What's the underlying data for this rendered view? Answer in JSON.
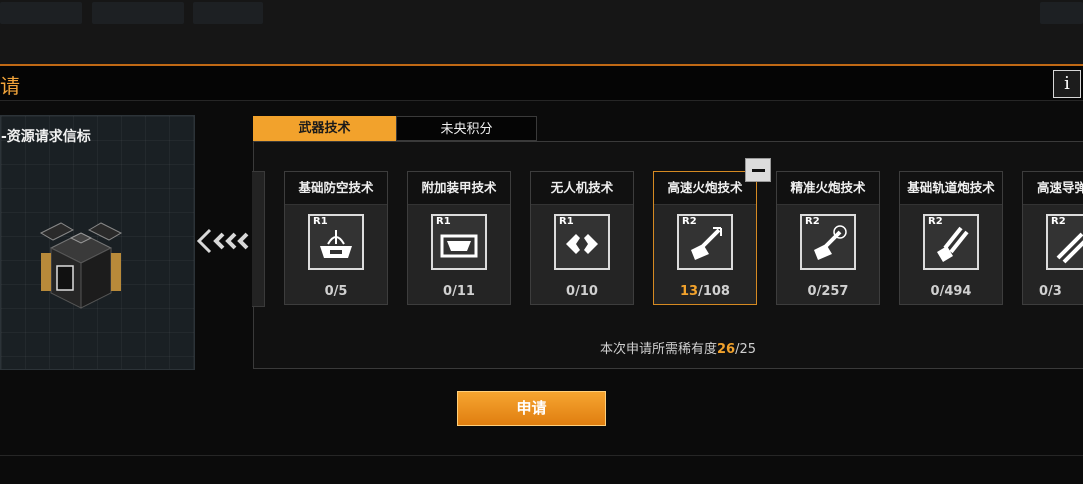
{
  "window": {
    "title": "请"
  },
  "beacon": {
    "name": "-资源请求信标"
  },
  "tabs": [
    {
      "label": "武器技术",
      "active": true
    },
    {
      "label": "未央积分",
      "active": false
    }
  ],
  "tech_cards": [
    {
      "name": "基础防空技术",
      "rank": "R1",
      "icon": "anti-air-icon",
      "current": "0",
      "sep": "/",
      "max": "5",
      "selected": false
    },
    {
      "name": "附加装甲技术",
      "rank": "R1",
      "icon": "armor-icon",
      "current": "0",
      "sep": "/",
      "max": "11",
      "selected": false
    },
    {
      "name": "无人机技术",
      "rank": "R1",
      "icon": "drone-icon",
      "current": "0",
      "sep": "/",
      "max": "10",
      "selected": false
    },
    {
      "name": "高速火炮技术",
      "rank": "R2",
      "icon": "rapid-cannon-icon",
      "current": "13",
      "sep": "/",
      "max": "108",
      "selected": true
    },
    {
      "name": "精准火炮技术",
      "rank": "R2",
      "icon": "precision-cannon-icon",
      "current": "0",
      "sep": "/",
      "max": "257",
      "selected": false
    },
    {
      "name": "基础轨道炮技术",
      "rank": "R2",
      "icon": "railgun-icon",
      "current": "0",
      "sep": "/",
      "max": "494",
      "selected": false
    },
    {
      "name": "高速导弹",
      "rank": "R2",
      "icon": "missile-icon",
      "current": "0",
      "sep": "/",
      "max": "3",
      "selected": false
    }
  ],
  "requirement": {
    "label": "本次申请所需稀有度",
    "current": "26",
    "sep": "/",
    "total": "25"
  },
  "apply_button": {
    "label": "申请"
  },
  "info_button": {
    "label": "i"
  },
  "colors": {
    "accent": "#f2a22c",
    "background": "#0b0b0b"
  }
}
